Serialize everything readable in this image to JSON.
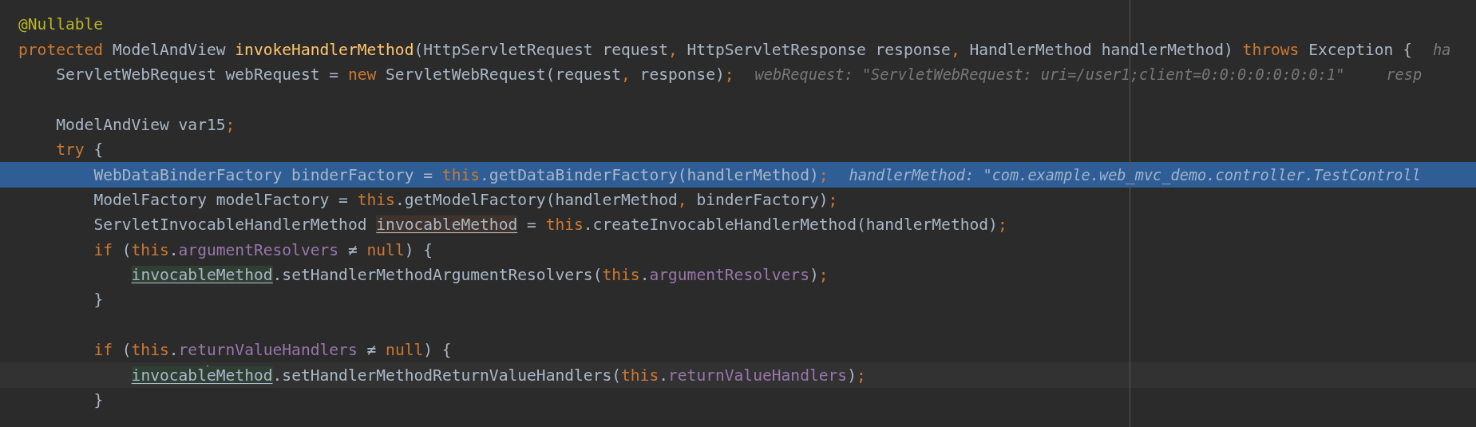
{
  "editor": {
    "lines": [
      {
        "selected": false,
        "tokens": [
          {
            "text": "@Nullable",
            "kind": "annotation"
          }
        ]
      },
      {
        "selected": false,
        "tokens": [
          {
            "text": "protected ",
            "kind": "keyword"
          },
          {
            "text": "ModelAndView ",
            "kind": "plain"
          },
          {
            "text": "invokeHandlerMethod",
            "kind": "method"
          },
          {
            "text": "(HttpServletRequest request",
            "kind": "plain"
          },
          {
            "text": ", ",
            "kind": "punct"
          },
          {
            "text": "HttpServletResponse response",
            "kind": "plain"
          },
          {
            "text": ", ",
            "kind": "punct"
          },
          {
            "text": "HandlerMethod handlerMethod) ",
            "kind": "plain"
          },
          {
            "text": "throws ",
            "kind": "keyword"
          },
          {
            "text": "Exception {",
            "kind": "plain"
          }
        ],
        "hints": [
          "ha"
        ],
        "children": [
          {
            "selected": false,
            "tokens": [
              {
                "text": "ServletWebRequest webRequest = ",
                "kind": "plain"
              },
              {
                "text": "new ",
                "kind": "keyword"
              },
              {
                "text": "ServletWebRequest(request",
                "kind": "plain"
              },
              {
                "text": ", ",
                "kind": "punct"
              },
              {
                "text": "response)",
                "kind": "plain"
              },
              {
                "text": ";",
                "kind": "punct"
              }
            ],
            "hints": [
              "webRequest: \"ServletWebRequest: uri=/user1;client=0:0:0:0:0:0:0:1\"",
              "resp"
            ]
          },
          {
            "selected": false
          },
          {
            "selected": false,
            "tokens": [
              {
                "text": "ModelAndView var15",
                "kind": "plain"
              },
              {
                "text": ";",
                "kind": "punct"
              }
            ]
          },
          {
            "selected": false,
            "tokens": [
              {
                "text": "try ",
                "kind": "keyword"
              },
              {
                "text": "{",
                "kind": "plain"
              }
            ],
            "children": [
              {
                "selected": true,
                "tokens": [
                  {
                    "text": "WebDataBinderFactory binderFactory = ",
                    "kind": "plain"
                  },
                  {
                    "text": "this",
                    "kind": "keyword"
                  },
                  {
                    "text": ".getDataBinderFactory(handlerMethod)",
                    "kind": "plain"
                  },
                  {
                    "text": ";",
                    "kind": "punct"
                  }
                ],
                "hints": [
                  "handlerMethod: \"com.example.web_mvc_demo.controller.TestControll"
                ]
              },
              {
                "selected": false,
                "tokens": [
                  {
                    "text": "ModelFactory modelFactory = ",
                    "kind": "plain"
                  },
                  {
                    "text": "this",
                    "kind": "keyword"
                  },
                  {
                    "text": ".getModelFactory(handlerMethod",
                    "kind": "plain"
                  },
                  {
                    "text": ", ",
                    "kind": "punct"
                  },
                  {
                    "text": "binderFactory)",
                    "kind": "plain"
                  },
                  {
                    "text": ";",
                    "kind": "punct"
                  }
                ]
              },
              {
                "selected": false,
                "tokens": [
                  {
                    "text": "ServletInvocableHandlerMethod ",
                    "kind": "plain"
                  },
                  {
                    "text": "invocableMethod",
                    "kind": "write-usage"
                  },
                  {
                    "text": " = ",
                    "kind": "plain"
                  },
                  {
                    "text": "this",
                    "kind": "keyword"
                  },
                  {
                    "text": ".createInvocableHandlerMethod(handlerMethod)",
                    "kind": "plain"
                  },
                  {
                    "text": ";",
                    "kind": "punct"
                  }
                ]
              },
              {
                "selected": false,
                "tokens": [
                  {
                    "text": "if ",
                    "kind": "keyword"
                  },
                  {
                    "text": "(",
                    "kind": "plain"
                  },
                  {
                    "text": "this",
                    "kind": "keyword"
                  },
                  {
                    "text": ".",
                    "kind": "plain"
                  },
                  {
                    "text": "argumentResolvers",
                    "kind": "field"
                  },
                  {
                    "text": " ≠ ",
                    "kind": "plain"
                  },
                  {
                    "text": "null",
                    "kind": "keyword"
                  },
                  {
                    "text": ") {",
                    "kind": "plain"
                  }
                ],
                "children": [
                  {
                    "selected": false,
                    "tokens": [
                      {
                        "text": "invocableMethod",
                        "kind": "read-usage"
                      },
                      {
                        "text": ".setHandlerMethodArgumentResolvers(",
                        "kind": "plain"
                      },
                      {
                        "text": "this",
                        "kind": "keyword"
                      },
                      {
                        "text": ".",
                        "kind": "plain"
                      },
                      {
                        "text": "argumentResolvers",
                        "kind": "field"
                      },
                      {
                        "text": ")",
                        "kind": "plain"
                      },
                      {
                        "text": ";",
                        "kind": "punct"
                      }
                    ]
                  }
                ]
              },
              {
                "selected": false,
                "tokens": [
                  {
                    "text": "}",
                    "kind": "plain"
                  }
                ]
              },
              {
                "selected": false
              },
              {
                "selected": false,
                "tokens": [
                  {
                    "text": "if ",
                    "kind": "keyword"
                  },
                  {
                    "text": "(",
                    "kind": "plain"
                  },
                  {
                    "text": "this",
                    "kind": "keyword"
                  },
                  {
                    "text": ".",
                    "kind": "plain"
                  },
                  {
                    "text": "returnValueHandlers",
                    "kind": "field"
                  },
                  {
                    "text": " ≠ ",
                    "kind": "plain"
                  },
                  {
                    "text": "null",
                    "kind": "keyword"
                  },
                  {
                    "text": ") {",
                    "kind": "plain"
                  }
                ],
                "children": [
                  {
                    "selected": false,
                    "tokens": [
                      {
                        "text": "invocabl",
                        "kind": "read-usage"
                      },
                      {
                        "kind": "caret"
                      },
                      {
                        "text": "eMethod",
                        "kind": "read-usage"
                      },
                      {
                        "text": ".setHandlerMethodReturnValueHandlers(",
                        "kind": "plain"
                      },
                      {
                        "text": "this",
                        "kind": "keyword"
                      },
                      {
                        "text": ".",
                        "kind": "plain"
                      },
                      {
                        "text": "returnValueHandlers",
                        "kind": "field"
                      },
                      {
                        "text": ")",
                        "kind": "plain"
                      },
                      {
                        "text": ";",
                        "kind": "punct"
                      }
                    ]
                  }
                ]
              },
              {
                "selected": false,
                "tokens": [
                  {
                    "text": "}",
                    "kind": "plain"
                  }
                ]
              }
            ]
          }
        ]
      }
    ]
  }
}
